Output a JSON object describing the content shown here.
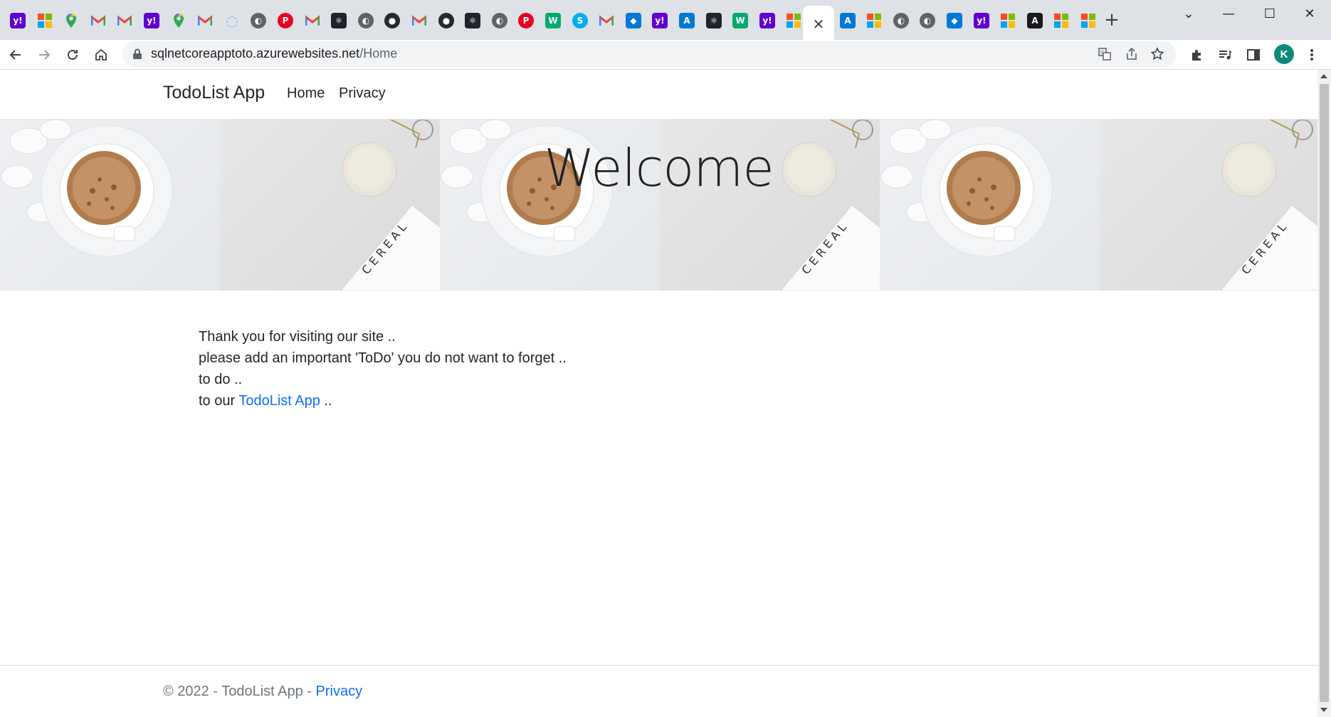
{
  "browser": {
    "tabs": [
      {
        "icon": "yahoo-icon",
        "color": "#6001d2",
        "glyph": "y!"
      },
      {
        "icon": "microsoft-icon",
        "color": "ms",
        "glyph": ""
      },
      {
        "icon": "google-maps-icon",
        "color": "#34a853",
        "glyph": "⬤"
      },
      {
        "icon": "gmail-icon",
        "color": "gmail",
        "glyph": "M"
      },
      {
        "icon": "gmail-icon",
        "color": "gmail",
        "glyph": "M"
      },
      {
        "icon": "yahoo-icon",
        "color": "#6001d2",
        "glyph": "y!"
      },
      {
        "icon": "google-maps-icon",
        "color": "#34a853",
        "glyph": "⬤"
      },
      {
        "icon": "gmail-icon",
        "color": "gmail",
        "glyph": "M"
      },
      {
        "icon": "loading-icon",
        "color": "#8ab4f8",
        "glyph": "◌"
      },
      {
        "icon": "globe-icon",
        "color": "#5f6368",
        "glyph": "◐"
      },
      {
        "icon": "pinterest-icon",
        "color": "#e60023",
        "glyph": "P"
      },
      {
        "icon": "gmail-icon",
        "color": "gmail",
        "glyph": "M"
      },
      {
        "icon": "react-icon",
        "color": "#20232a",
        "glyph": "⚛"
      },
      {
        "icon": "globe-icon",
        "color": "#5f6368",
        "glyph": "◐"
      },
      {
        "icon": "github-icon",
        "color": "#24292e",
        "glyph": "●"
      },
      {
        "icon": "gmail-icon",
        "color": "gmail",
        "glyph": "M"
      },
      {
        "icon": "github-icon",
        "color": "#24292e",
        "glyph": "●"
      },
      {
        "icon": "react-icon",
        "color": "#20232a",
        "glyph": "⚛"
      },
      {
        "icon": "globe-icon",
        "color": "#5f6368",
        "glyph": "◐"
      },
      {
        "icon": "pinterest-icon",
        "color": "#e60023",
        "glyph": "P"
      },
      {
        "icon": "w3schools-icon",
        "color": "#04aa6d",
        "glyph": "W"
      },
      {
        "icon": "skype-icon",
        "color": "#00aff0",
        "glyph": "S"
      },
      {
        "icon": "gmail-icon",
        "color": "gmail",
        "glyph": "M"
      },
      {
        "icon": "azure-devops-icon",
        "color": "#0078d4",
        "glyph": "◆"
      },
      {
        "icon": "yahoo-icon",
        "color": "#6001d2",
        "glyph": "y!"
      },
      {
        "icon": "azure-icon",
        "color": "#0078d4",
        "glyph": "A"
      },
      {
        "icon": "react-icon",
        "color": "#20232a",
        "glyph": "⚛"
      },
      {
        "icon": "w3schools-icon",
        "color": "#04aa6d",
        "glyph": "W"
      },
      {
        "icon": "yahoo-icon",
        "color": "#6001d2",
        "glyph": "y!"
      },
      {
        "icon": "microsoft-icon",
        "color": "ms",
        "glyph": ""
      },
      {
        "icon": "close-icon",
        "color": "active",
        "glyph": "✕"
      },
      {
        "icon": "azure-icon",
        "color": "#0078d4",
        "glyph": "A"
      },
      {
        "icon": "microsoft-icon",
        "color": "ms",
        "glyph": ""
      },
      {
        "icon": "globe-icon",
        "color": "#5f6368",
        "glyph": "◐"
      },
      {
        "icon": "globe-icon",
        "color": "#5f6368",
        "glyph": "◐"
      },
      {
        "icon": "azure-devops-icon",
        "color": "#0078d4",
        "glyph": "◆"
      },
      {
        "icon": "yahoo-icon",
        "color": "#6001d2",
        "glyph": "y!"
      },
      {
        "icon": "microsoft-icon",
        "color": "ms",
        "glyph": ""
      },
      {
        "icon": "angular-icon",
        "color": "#1a1a1a",
        "glyph": "A"
      },
      {
        "icon": "microsoft-icon",
        "color": "ms",
        "glyph": ""
      },
      {
        "icon": "microsoft-icon",
        "color": "ms",
        "glyph": ""
      }
    ],
    "new_tab": "+",
    "url_host": "sqlnetcoreapptoto.azurewebsites.net",
    "url_path": "/Home",
    "profile_initial": "K"
  },
  "site": {
    "brand": "TodoList App",
    "nav": [
      {
        "label": "Home"
      },
      {
        "label": "Privacy"
      }
    ],
    "hero_title": "Welcome",
    "hero_card_text": "CEREAL",
    "content": {
      "line1": "Thank you for visiting our site ..",
      "line2": "please add an important 'ToDo' you do not want to forget ..",
      "line3": "to do ..",
      "line4_prefix": "to our ",
      "line4_link": "TodoList App",
      "line4_suffix": " .."
    },
    "footer": {
      "text": "© 2022 - TodoList App - ",
      "link": "Privacy"
    }
  },
  "colors": {
    "link": "#0d6efd",
    "text": "#212529",
    "footer_text": "#6c757d"
  }
}
